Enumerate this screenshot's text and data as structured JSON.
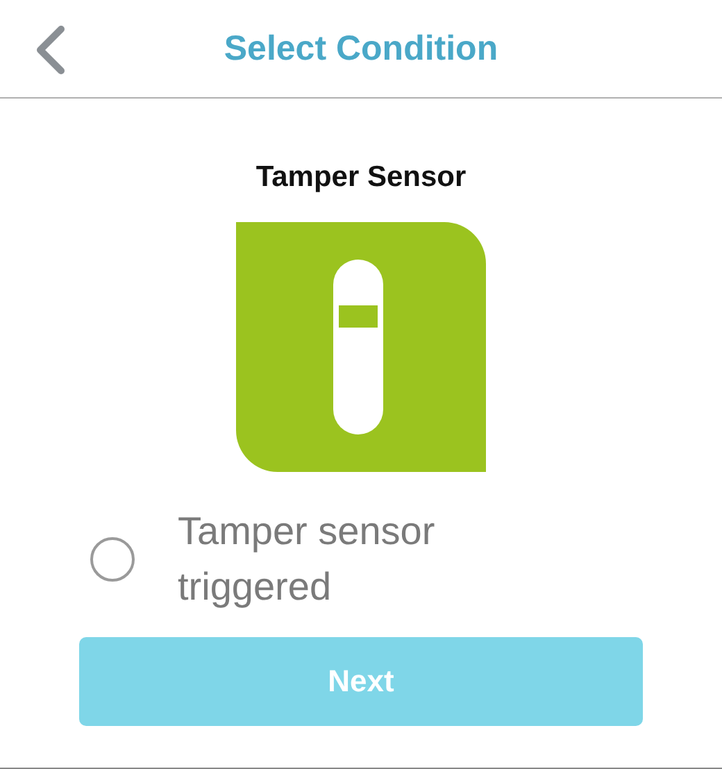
{
  "header": {
    "title": "Select Condition"
  },
  "device": {
    "name": "Tamper Sensor"
  },
  "options": [
    {
      "label": "Tamper sensor triggered",
      "selected": false
    }
  ],
  "buttons": [
    {
      "label": "Next"
    }
  ]
}
